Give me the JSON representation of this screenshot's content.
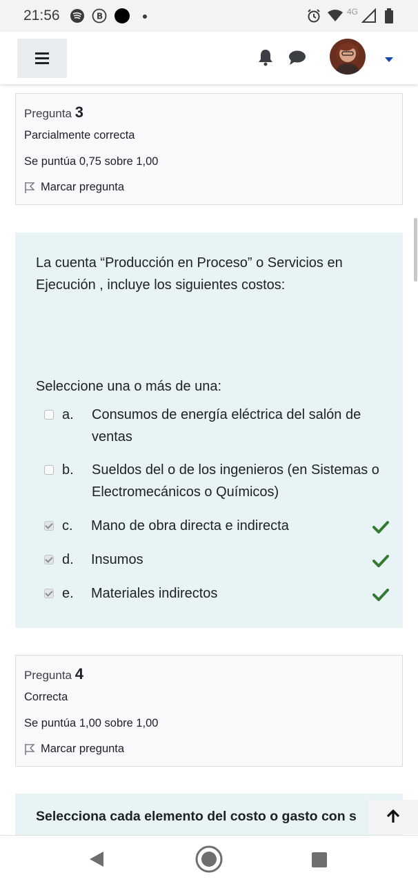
{
  "status_bar": {
    "time": "21:56",
    "network": "4G",
    "icons": [
      "spotify-icon",
      "b-badge-icon",
      "dot-icon",
      "alarm-icon",
      "wifi-icon",
      "signal-icon",
      "battery-icon"
    ]
  },
  "nav": {
    "menu_icon": "hamburger-icon",
    "notification_icon": "bell-icon",
    "messages_icon": "chat-icon",
    "user_menu_icon": "caret-down-icon"
  },
  "question3": {
    "label": "Pregunta",
    "number": "3",
    "state": "Parcialmente correcta",
    "grade": "Se puntúa 0,75 sobre 1,00",
    "flag_label": "Marcar pregunta",
    "text": "La cuenta “Producción en Proceso” o Servicios en Ejecución , incluye los siguientes costos:",
    "prompt": "Seleccione una o más de una:",
    "answers": [
      {
        "letter": "a.",
        "text": "Consumos de energía eléctrica del salón de ventas",
        "checked": false,
        "correct": false
      },
      {
        "letter": "b.",
        "text": "Sueldos del o de los ingenieros (en Sistemas o Electromecánicos o Químicos)",
        "checked": false,
        "correct": false
      },
      {
        "letter": "c.",
        "text": "Mano de obra directa e indirecta",
        "checked": true,
        "correct": true
      },
      {
        "letter": "d.",
        "text": "Insumos",
        "checked": true,
        "correct": true
      },
      {
        "letter": "e.",
        "text": "Materiales indirectos",
        "checked": true,
        "correct": true
      }
    ]
  },
  "question4": {
    "label": "Pregunta",
    "number": "4",
    "state": "Correcta",
    "grade": "Se puntúa 1,00 sobre 1,00",
    "flag_label": "Marcar pregunta",
    "text_visible": "Selecciona cada elemento del costo o gasto con s"
  },
  "colors": {
    "accent_bg": "#e7f3f5",
    "correct_green": "#357a32",
    "info_bg": "#f8f9fa",
    "nav_caret": "#0f47ad"
  }
}
